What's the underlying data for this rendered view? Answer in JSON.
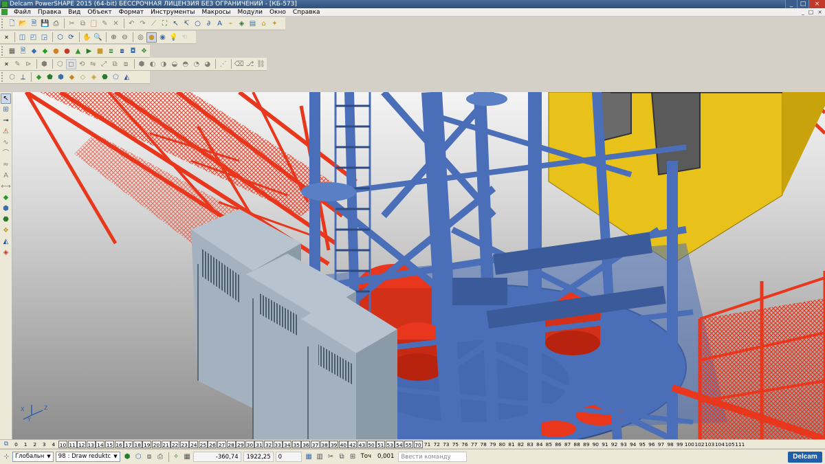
{
  "window": {
    "title": "Delcam PowerSHAPE 2015 (64-bit) БЕССРОЧНАЯ ЛИЦЕНЗИЯ БЕЗ ОГРАНИЧЕНИЙ - [КБ-573]",
    "minimize": "_",
    "restore": "□",
    "close": "×"
  },
  "menu": {
    "items": [
      "Файл",
      "Правка",
      "Вид",
      "Объект",
      "Формат",
      "Инструменты",
      "Макросы",
      "Модули",
      "Окно",
      "Справка"
    ],
    "mdi": [
      "_",
      "□",
      "×"
    ]
  },
  "levels": {
    "labels": [
      "0",
      "1",
      "2",
      "3",
      "4",
      "10",
      "11",
      "12",
      "13",
      "14",
      "15",
      "16",
      "17",
      "18",
      "19",
      "20",
      "21",
      "22",
      "23",
      "24",
      "25",
      "26",
      "27",
      "28",
      "29",
      "30",
      "31",
      "32",
      "33",
      "34",
      "35",
      "36",
      "37",
      "38",
      "39",
      "40",
      "42",
      "43",
      "50",
      "51",
      "53",
      "54",
      "55",
      "70",
      "71",
      "72",
      "73",
      "75",
      "76",
      "77",
      "78",
      "79",
      "80",
      "81",
      "82",
      "83",
      "84",
      "85",
      "86",
      "87",
      "88",
      "89",
      "90",
      "91",
      "92",
      "93",
      "94",
      "95",
      "96",
      "97",
      "98",
      "99",
      "100",
      "102",
      "103",
      "104",
      "105",
      "111"
    ],
    "active_range": [
      5,
      43
    ]
  },
  "status": {
    "workplane": "Глобальн",
    "level_number": "98",
    "level_name": ": Draw reduktc",
    "x": "-360,74",
    "y": "1922,25",
    "z": "0",
    "tolerance_label": "Точ",
    "tolerance": "0,001",
    "command_placeholder": "Ввести команду",
    "logo": "Delcam"
  },
  "viewport": {
    "axis_labels": {
      "x": "X",
      "y": "Y",
      "z": "Z"
    }
  },
  "colors": {
    "crane_red": "#e8371c",
    "tower_blue": "#4a6fb8",
    "cabin_yellow": "#e8c21a",
    "cabinet_gray": "#9aabb8"
  }
}
